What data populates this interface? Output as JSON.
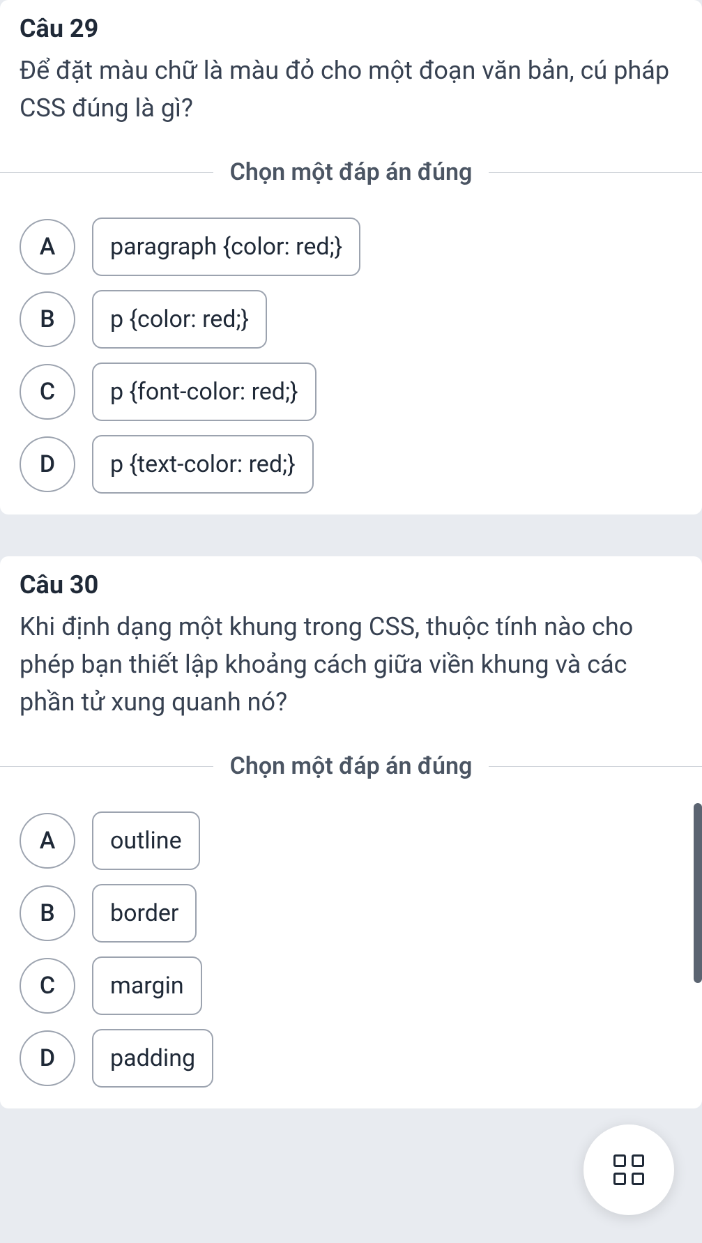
{
  "instruction": "Chọn một đáp án đúng",
  "fab": {
    "name": "grid-menu"
  },
  "questions": [
    {
      "number": "Câu 29",
      "text": "Để đặt màu chữ là màu đỏ cho một đoạn văn bản, cú pháp CSS đúng là gì?",
      "options": [
        {
          "letter": "A",
          "text": "paragraph {color: red;}"
        },
        {
          "letter": "B",
          "text": "p {color: red;}"
        },
        {
          "letter": "C",
          "text": "p {font-color: red;}"
        },
        {
          "letter": "D",
          "text": "p {text-color: red;}"
        }
      ]
    },
    {
      "number": "Câu 30",
      "text": "Khi định dạng một khung trong CSS, thuộc tính nào cho phép bạn thiết lập khoảng cách giữa viền khung và các phần tử xung quanh nó?",
      "options": [
        {
          "letter": "A",
          "text": "outline"
        },
        {
          "letter": "B",
          "text": "border"
        },
        {
          "letter": "C",
          "text": "margin"
        },
        {
          "letter": "D",
          "text": "padding"
        }
      ]
    }
  ]
}
